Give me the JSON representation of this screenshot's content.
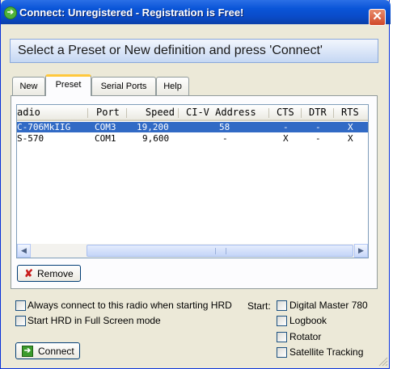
{
  "window": {
    "title": "Connect: Unregistered - Registration is Free!",
    "close_glyph": "✕",
    "app_icon_glyph": "➔"
  },
  "header": {
    "text": "Select a Preset or New definition and press 'Connect'"
  },
  "tabs": [
    {
      "label": "New"
    },
    {
      "label": "Preset"
    },
    {
      "label": "Serial Ports"
    },
    {
      "label": "Help"
    }
  ],
  "table": {
    "columns": [
      "adio",
      "Port",
      "Speed",
      "CI-V Address",
      "CTS",
      "DTR",
      "RTS"
    ],
    "rows": [
      {
        "radio": "C-706MkIIG",
        "port": "COM3",
        "speed": "19,200",
        "civ": "58",
        "cts": "-",
        "dtr": "-",
        "rts": "X",
        "selected": true
      },
      {
        "radio": "S-570",
        "port": "COM1",
        "speed": "9,600",
        "civ": "-",
        "cts": "X",
        "dtr": "-",
        "rts": "X",
        "selected": false
      }
    ]
  },
  "scrollbar": {
    "left_glyph": "◀",
    "right_glyph": "▶"
  },
  "remove_button": {
    "label": "Remove",
    "icon_glyph": "✘"
  },
  "options": {
    "always_connect": "Always connect to this radio when starting HRD",
    "full_screen": "Start HRD in Full Screen mode"
  },
  "start": {
    "label": "Start:",
    "items": [
      "Digital Master 780",
      "Logbook",
      "Rotator",
      "Satellite Tracking"
    ]
  },
  "connect_button": {
    "label": "Connect",
    "icon_glyph": "➔"
  },
  "colors": {
    "titlebar": "#0a55d8",
    "selection": "#316ac5",
    "active_tab_accent": "#ffc83c"
  }
}
